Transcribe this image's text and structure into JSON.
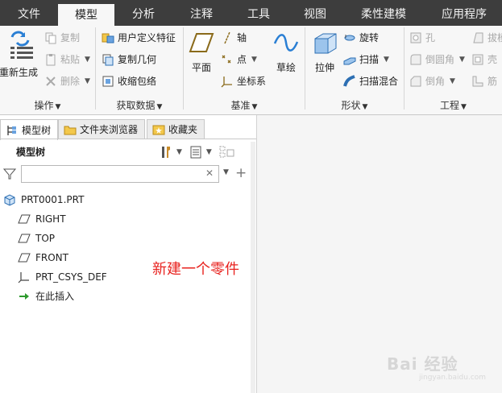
{
  "menubar": {
    "tabs": [
      {
        "label": "文件",
        "active": false
      },
      {
        "label": "模型",
        "active": true
      },
      {
        "label": "分析",
        "active": false
      },
      {
        "label": "注释",
        "active": false
      },
      {
        "label": "工具",
        "active": false
      },
      {
        "label": "视图",
        "active": false
      },
      {
        "label": "柔性建模",
        "active": false
      },
      {
        "label": "应用程序",
        "active": false
      }
    ]
  },
  "ribbon": {
    "operations": {
      "label": "操作",
      "regenerate": "重新生成",
      "copy": "复制",
      "paste": "粘贴",
      "delete": "删除"
    },
    "get_data": {
      "label": "获取数据",
      "udf": "用户定义特征",
      "copy_geometry": "复制几何",
      "shrinkwrap": "收缩包络"
    },
    "datum": {
      "label": "基准",
      "plane": "平面",
      "axis": "轴",
      "point": "点",
      "csys": "坐标系",
      "sketch": "草绘"
    },
    "shapes": {
      "label": "形状",
      "extrude": "拉伸",
      "revolve": "旋转",
      "sweep": "扫描",
      "swept_blend": "扫描混合"
    },
    "engineering": {
      "label": "工程",
      "hole": "孔",
      "round": "倒圆角",
      "chamfer": "倒角",
      "draft": "拔模",
      "shell": "壳",
      "rib": "筋"
    }
  },
  "panel": {
    "tabs": [
      {
        "label": "模型树",
        "active": true
      },
      {
        "label": "文件夹浏览器",
        "active": false
      },
      {
        "label": "收藏夹",
        "active": false
      }
    ],
    "tree_title": "模型树",
    "filter": {
      "value": "",
      "placeholder": ""
    }
  },
  "tree": {
    "items": [
      {
        "label": "PRT0001.PRT",
        "icon": "part-icon"
      },
      {
        "label": "RIGHT",
        "icon": "datum-plane-icon"
      },
      {
        "label": "TOP",
        "icon": "datum-plane-icon"
      },
      {
        "label": "FRONT",
        "icon": "datum-plane-icon"
      },
      {
        "label": "PRT_CSYS_DEF",
        "icon": "csys-icon"
      },
      {
        "label": "在此插入",
        "icon": "insert-arrow-icon"
      }
    ]
  },
  "annotation": "新建一个零件",
  "watermark": {
    "main": "Bai 经验",
    "sub": "jingyan.baidu.com"
  },
  "colors": {
    "menubar": "#3d3d3d",
    "accent": "#3a8ee6",
    "annotation": "#e8231f"
  }
}
